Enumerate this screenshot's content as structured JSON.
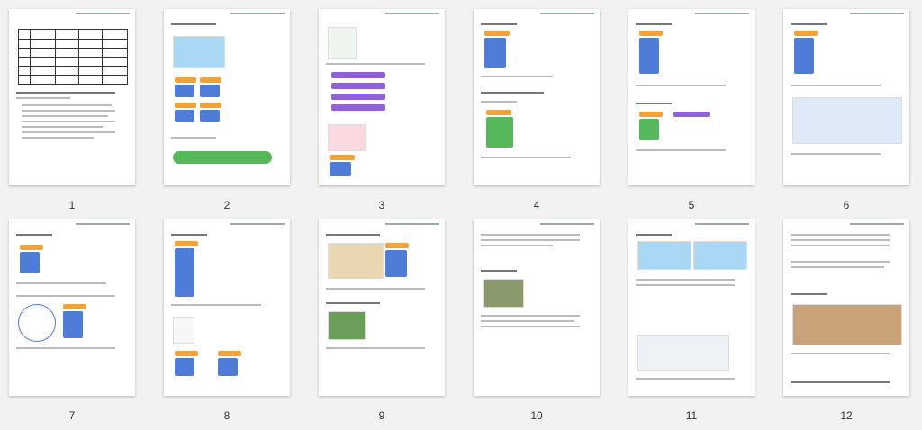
{
  "viewer": {
    "title": "",
    "pages": [
      {
        "label": "1"
      },
      {
        "label": "2"
      },
      {
        "label": "3"
      },
      {
        "label": "4"
      },
      {
        "label": "5"
      },
      {
        "label": "6"
      },
      {
        "label": "7"
      },
      {
        "label": "8"
      },
      {
        "label": "9"
      },
      {
        "label": "10"
      },
      {
        "label": "11"
      },
      {
        "label": "12"
      }
    ]
  }
}
